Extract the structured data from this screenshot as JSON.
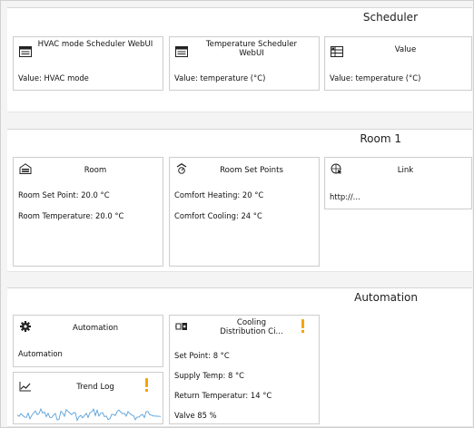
{
  "sections": {
    "scheduler": {
      "title": "Scheduler"
    },
    "room1": {
      "title": "Room 1"
    },
    "automation": {
      "title": "Automation"
    }
  },
  "tiles": {
    "hvac_scheduler": {
      "title": "HVAC mode Scheduler WebUI",
      "value": "Value: HVAC mode",
      "icon": "scheduler-icon"
    },
    "temp_scheduler": {
      "title": "Temperature Scheduler WebUI",
      "value": "Value: temperature (°C)",
      "icon": "scheduler-icon"
    },
    "value": {
      "title": "Value",
      "value": "Value: temperature (°C)",
      "icon": "value-grid-icon"
    },
    "room": {
      "title": "Room",
      "line1": "Room Set Point: 20.0 °C",
      "line2": "Room Temperature: 20.0 °C",
      "icon": "room-icon"
    },
    "room_set_points": {
      "title": "Room Set Points",
      "line1": "Comfort Heating: 20  °C",
      "line2": "Comfort Cooling: 24  °C",
      "icon": "thermostat-icon"
    },
    "link": {
      "title": "Link",
      "line1": "http://...",
      "icon": "link-globe-icon"
    },
    "automation": {
      "title": "Automation",
      "line1": "Automation",
      "icon": "gear-icon"
    },
    "cooling": {
      "title_line1": "Cooling",
      "title_line2": "Distribution Ci...",
      "line1": "Set Point: 8 °C",
      "line2": "Supply Temp: 8 °C",
      "line3": "Return Temperatur: 14 °C",
      "line4": "Valve 85 %",
      "icon": "cooling-distribution-icon",
      "alert": "warning-icon"
    },
    "trend_log": {
      "title": "Trend Log",
      "icon": "trend-chart-icon",
      "alert": "warning-icon"
    }
  },
  "colors": {
    "warning": "#f4a500",
    "sparkline": "#5aa0d8",
    "border": "#cfcfcf"
  }
}
